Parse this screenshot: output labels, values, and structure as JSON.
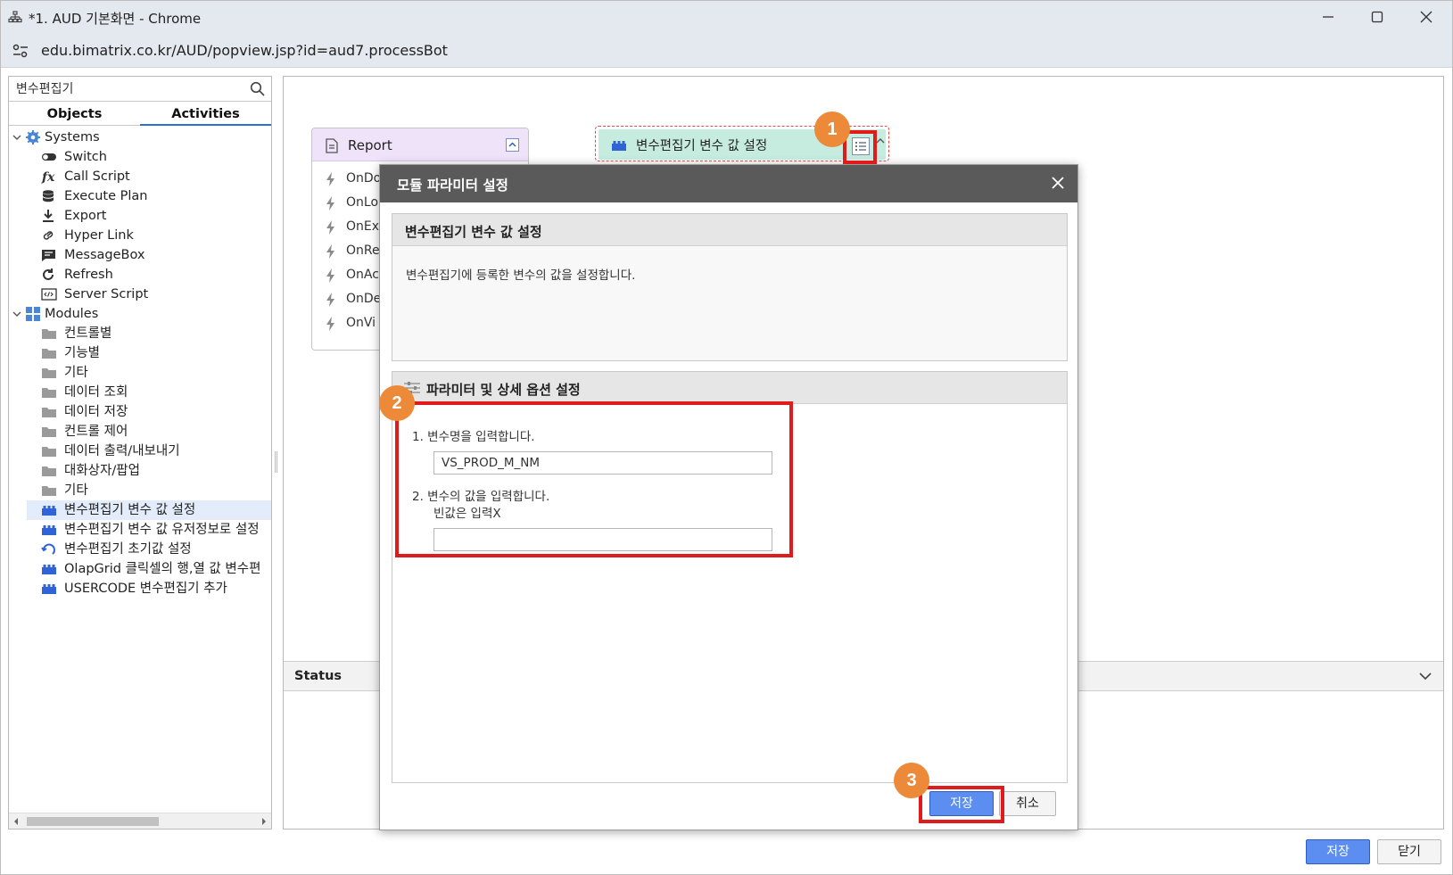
{
  "window": {
    "title": "*1. AUD 기본화면 - Chrome",
    "url": "edu.bimatrix.co.kr/AUD/popview.jsp?id=aud7.processBot"
  },
  "left_panel": {
    "search_value": "변수편집기",
    "tabs": [
      "Objects",
      "Activities"
    ],
    "active_tab": "Activities",
    "systems_label": "Systems",
    "system_items": [
      "Switch",
      "Call Script",
      "Execute Plan",
      "Export",
      "Hyper Link",
      "MessageBox",
      "Refresh",
      "Server Script"
    ],
    "modules_label": "Modules",
    "module_folders": [
      "컨트롤별",
      "기능별",
      "기타",
      "데이터 조회",
      "데이터 저장",
      "컨트롤 제어",
      "데이터 출력/내보내기",
      "대화상자/팝업",
      "기타"
    ],
    "module_items": [
      "변수편집기 변수 값 설정",
      "변수편집기 변수 값 유저정보로 설정",
      "변수편집기 초기값 설정",
      "OlapGrid 클릭셀의 행,열 값 변수편",
      "USERCODE 변수편집기 추가"
    ],
    "selected_item": "변수편집기 변수 값 설정"
  },
  "canvas": {
    "report": {
      "name": "Report",
      "events": [
        "OnDo",
        "OnLo",
        "OnEx",
        "OnRe",
        "OnAc",
        "OnDe",
        "OnVi"
      ]
    },
    "module_node": {
      "name": "변수편집기 변수 값 설정"
    }
  },
  "status": {
    "label": "Status"
  },
  "modal": {
    "title": "모듈 파라미터 설정",
    "section1_title": "변수편집기 변수 값 설정",
    "section1_desc": "변수편집기에 등록한 변수의 값을 설정합니다.",
    "section2_title": "파라미터 및 상세 옵션 설정",
    "param1_label": "1. 변수명을 입력합니다.",
    "param1_value": "VS_PROD_M_NM",
    "param2_label_line1": "2. 변수의 값을 입력합니다.",
    "param2_label_line2": "빈값은 입력X",
    "param2_value": "",
    "save_label": "저장",
    "cancel_label": "취소"
  },
  "footer": {
    "save_label": "저장",
    "close_label": "닫기"
  },
  "annotations": {
    "badge1": "1",
    "badge2": "2",
    "badge3": "3"
  },
  "colors": {
    "highlight": "#e01b1b",
    "badge": "#ec8a3a",
    "primary_button": "#5b8ef0",
    "module_header": "#c6ece0",
    "report_header": "#eee3f8"
  }
}
